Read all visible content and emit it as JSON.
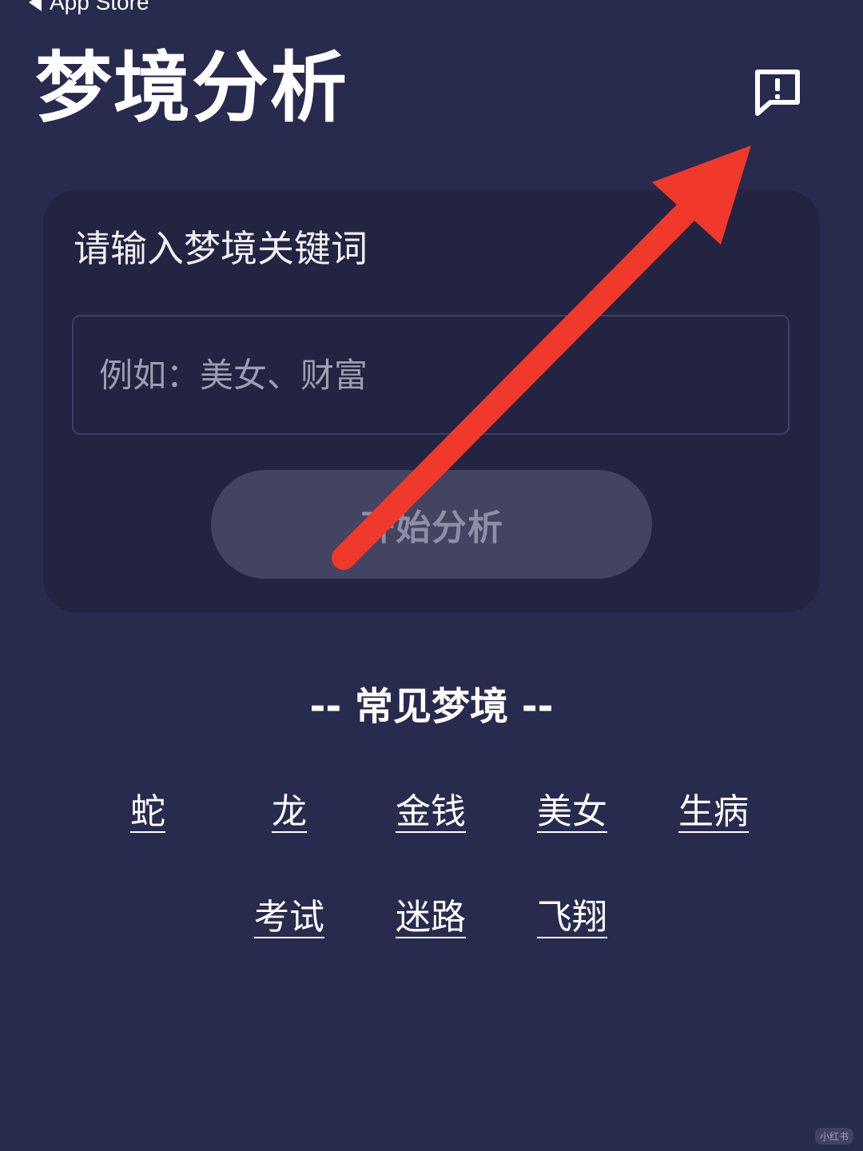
{
  "status_bar": {
    "back_label": "App Store"
  },
  "header": {
    "title": "梦境分析",
    "feedback_icon": "feedback-icon"
  },
  "search_card": {
    "label": "请输入梦境关键词",
    "input_value": "",
    "input_placeholder": "例如：美女、财富",
    "button_label": "开始分析"
  },
  "common_dreams": {
    "heading": "-- 常见梦境 --",
    "items": [
      "蛇",
      "龙",
      "金钱",
      "美女",
      "生病",
      "考试",
      "迷路",
      "飞翔"
    ]
  },
  "annotation": {
    "arrow_color": "#f0392b"
  },
  "watermark": {
    "text": "小红书"
  },
  "colors": {
    "background": "#282a4e",
    "card": "#222442",
    "button": "#434461"
  }
}
